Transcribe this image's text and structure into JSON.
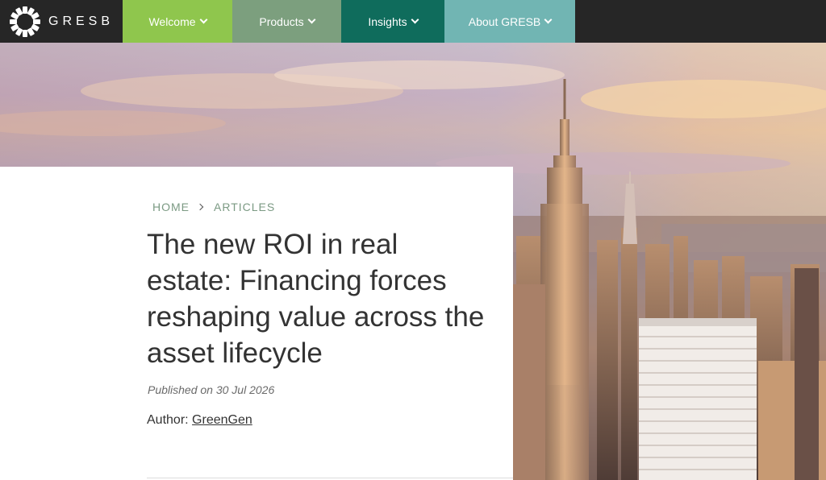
{
  "brand": {
    "name": "GRESB"
  },
  "nav": {
    "items": [
      {
        "label": "Welcome",
        "color": "#8fc64d"
      },
      {
        "label": "Products",
        "color": "#7c9f7e"
      },
      {
        "label": "Insights",
        "color": "#0f6c5c"
      },
      {
        "label": "About GRESB",
        "color": "#71b5b3"
      }
    ]
  },
  "breadcrumb": {
    "home": "HOME",
    "current": "ARTICLES"
  },
  "article": {
    "title": "The new ROI in real estate: Financing forces reshaping value across the asset lifecycle",
    "published": "Published on 30 Jul 2026",
    "author_prefix": "Author:",
    "author_name": "GreenGen"
  },
  "colors": {
    "topbar": "#262626",
    "breadcrumb": "#7b9a83",
    "text": "#333333"
  }
}
